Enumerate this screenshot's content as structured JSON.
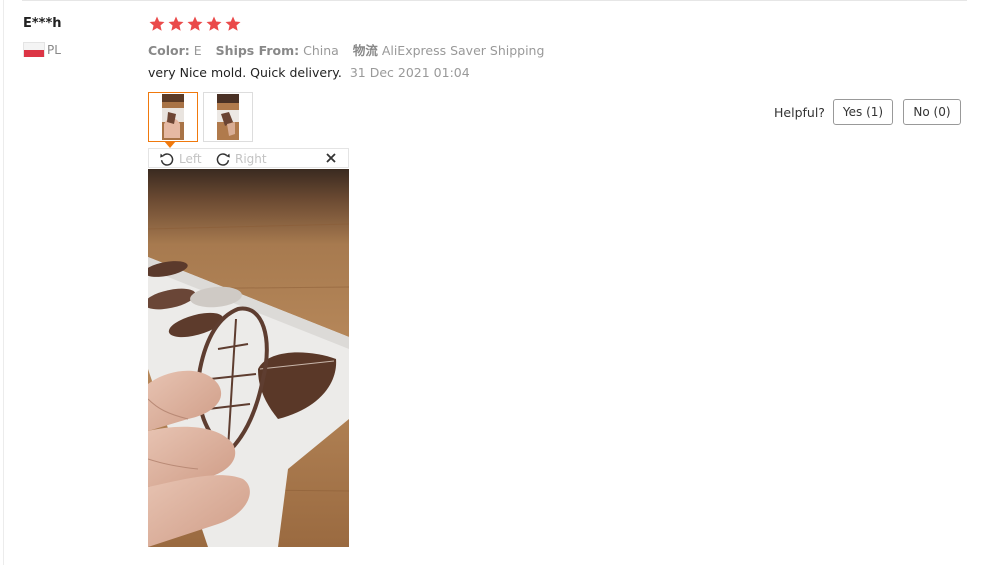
{
  "reviewer": {
    "name": "E***h",
    "country_code": "PL"
  },
  "rating": {
    "stars": 5,
    "max": 5,
    "color": "#ea4a4a"
  },
  "attributes": {
    "color_label": "Color:",
    "color_value": "E",
    "ships_label": "Ships From:",
    "ships_value": "China",
    "logistics_label": "物流",
    "logistics_value": "AliExpress Saver Shipping"
  },
  "review": {
    "text": "very Nice mold. Quick delivery.",
    "date": "31 Dec 2021 01:04"
  },
  "thumbnails": [
    {
      "selected": true
    },
    {
      "selected": false
    }
  ],
  "viewer": {
    "rotate_left_label": "Left",
    "rotate_right_label": "Right"
  },
  "feedback": {
    "question": "Helpful?",
    "yes_label": "Yes (1)",
    "no_label": "No (0)"
  },
  "colors": {
    "accent": "#f0790d",
    "star": "#ea4a4a"
  }
}
